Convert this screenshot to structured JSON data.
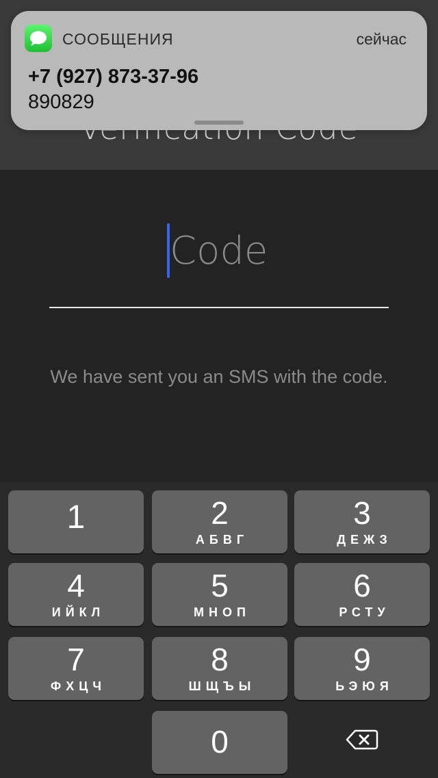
{
  "screen": {
    "title": "Verification Code"
  },
  "notification": {
    "app_name": "СООБЩЕНИЯ",
    "time": "сейчас",
    "sender": "+7 (927) 873-37-96",
    "body": "890829",
    "app_icon": "messages-icon"
  },
  "code_input": {
    "placeholder": "Code",
    "value": ""
  },
  "hint": "We have sent you an SMS with the code.",
  "keypad": {
    "keys": [
      {
        "digit": "1",
        "letters": ""
      },
      {
        "digit": "2",
        "letters": "АБВГ"
      },
      {
        "digit": "3",
        "letters": "ДЕЖЗ"
      },
      {
        "digit": "4",
        "letters": "ИЙКЛ"
      },
      {
        "digit": "5",
        "letters": "МНОП"
      },
      {
        "digit": "6",
        "letters": "РСТУ"
      },
      {
        "digit": "7",
        "letters": "ФХЦЧ"
      },
      {
        "digit": "8",
        "letters": "ШЩЪЫ"
      },
      {
        "digit": "9",
        "letters": "ЬЭЮЯ"
      },
      {
        "digit": "0",
        "letters": ""
      }
    ],
    "delete_icon": "backspace-icon"
  },
  "colors": {
    "background": "#232323",
    "header": "#3a3a3a",
    "cursor": "#3a63f0",
    "key": "#636363",
    "notification": "#b9b9b9",
    "messages_green": "#34c759"
  }
}
